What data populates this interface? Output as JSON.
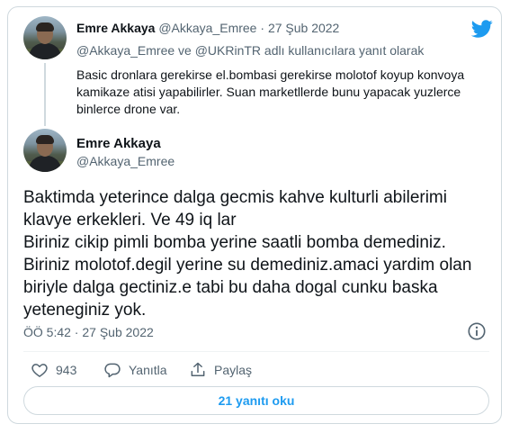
{
  "parent_tweet": {
    "author_name": "Emre Akkaya",
    "author_handle": "@Akkaya_Emree",
    "date_separator": "·",
    "date": "27 Şub 2022",
    "replying_to": "@Akkaya_Emree ve @UKRinTR adlı kullanıcılara yanıt olarak",
    "text": "Basic dronlara gerekirse el.bombasi gerekirse molotof koyup konvoya kamikaze atisi yapabilirler. Suan marketllerde bunu yapacak yuzlerce binlerce drone var."
  },
  "main_tweet": {
    "author_name": "Emre Akkaya",
    "author_handle": "@Akkaya_Emree",
    "text": "Baktimda yeterince dalga gecmis kahve kulturli abilerimi klavye erkekleri. Ve 49 iq lar\nBiriniz cikip pimli bomba yerine saatli bomba demediniz. Biriniz molotof.degil yerine su demediniz.amaci yardim olan biriyle dalga gectiniz.e tabi bu daha dogal cunku baska yeteneginiz yok.",
    "timestamp": "ÖÖ 5:42 · 27 Şub 2022"
  },
  "actions": {
    "like_count": "943",
    "reply_label": "Yanıtla",
    "share_label": "Paylaş"
  },
  "read_replies_label": "21 yanıtı oku",
  "icons": {
    "brand": "twitter-bird-icon",
    "info": "info-icon",
    "like": "heart-icon",
    "reply": "reply-bubble-icon",
    "share": "share-icon"
  },
  "colors": {
    "brand": "#1d9bf0",
    "text": "#0f1419",
    "muted": "#536471",
    "border": "#cfd9de"
  }
}
